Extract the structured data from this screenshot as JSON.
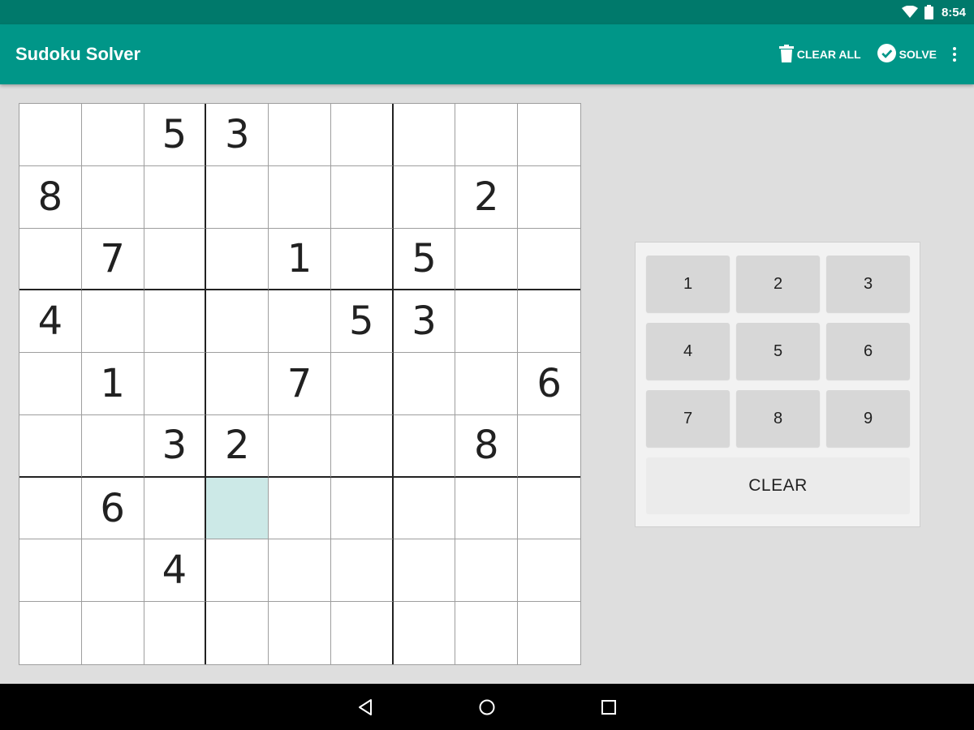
{
  "status_bar": {
    "time": "8:54",
    "icons": [
      "wifi-icon",
      "battery-icon"
    ]
  },
  "app_bar": {
    "title": "Sudoku Solver",
    "clear_all_label": "CLEAR ALL",
    "solve_label": "SOLVE",
    "icons": [
      "trash-icon",
      "check-circle-icon",
      "more-vert-icon"
    ]
  },
  "board": {
    "selected": {
      "row": 6,
      "col": 3
    },
    "rows": [
      [
        "",
        "",
        "5",
        "3",
        "",
        "",
        "",
        "",
        ""
      ],
      [
        "8",
        "",
        "",
        "",
        "",
        "",
        "",
        "2",
        ""
      ],
      [
        "",
        "7",
        "",
        "",
        "1",
        "",
        "5",
        "",
        ""
      ],
      [
        "4",
        "",
        "",
        "",
        "",
        "5",
        "3",
        "",
        ""
      ],
      [
        "",
        "1",
        "",
        "",
        "7",
        "",
        "",
        "",
        "6"
      ],
      [
        "",
        "",
        "3",
        "2",
        "",
        "",
        "",
        "8",
        ""
      ],
      [
        "",
        "6",
        "",
        "",
        "",
        "",
        "",
        "",
        ""
      ],
      [
        "",
        "",
        "4",
        "",
        "",
        "",
        "",
        "",
        ""
      ],
      [
        "",
        "",
        "",
        "",
        "",
        "",
        "",
        "",
        ""
      ]
    ]
  },
  "keypad": {
    "keys": [
      "1",
      "2",
      "3",
      "4",
      "5",
      "6",
      "7",
      "8",
      "9"
    ],
    "clear_label": "CLEAR"
  },
  "nav_bar": {
    "icons": [
      "back-icon",
      "home-icon",
      "recents-icon"
    ]
  },
  "colors": {
    "status_bar": "#00796b",
    "app_bar": "#009688",
    "selected_cell": "#cce9e7",
    "background": "#dedede"
  }
}
